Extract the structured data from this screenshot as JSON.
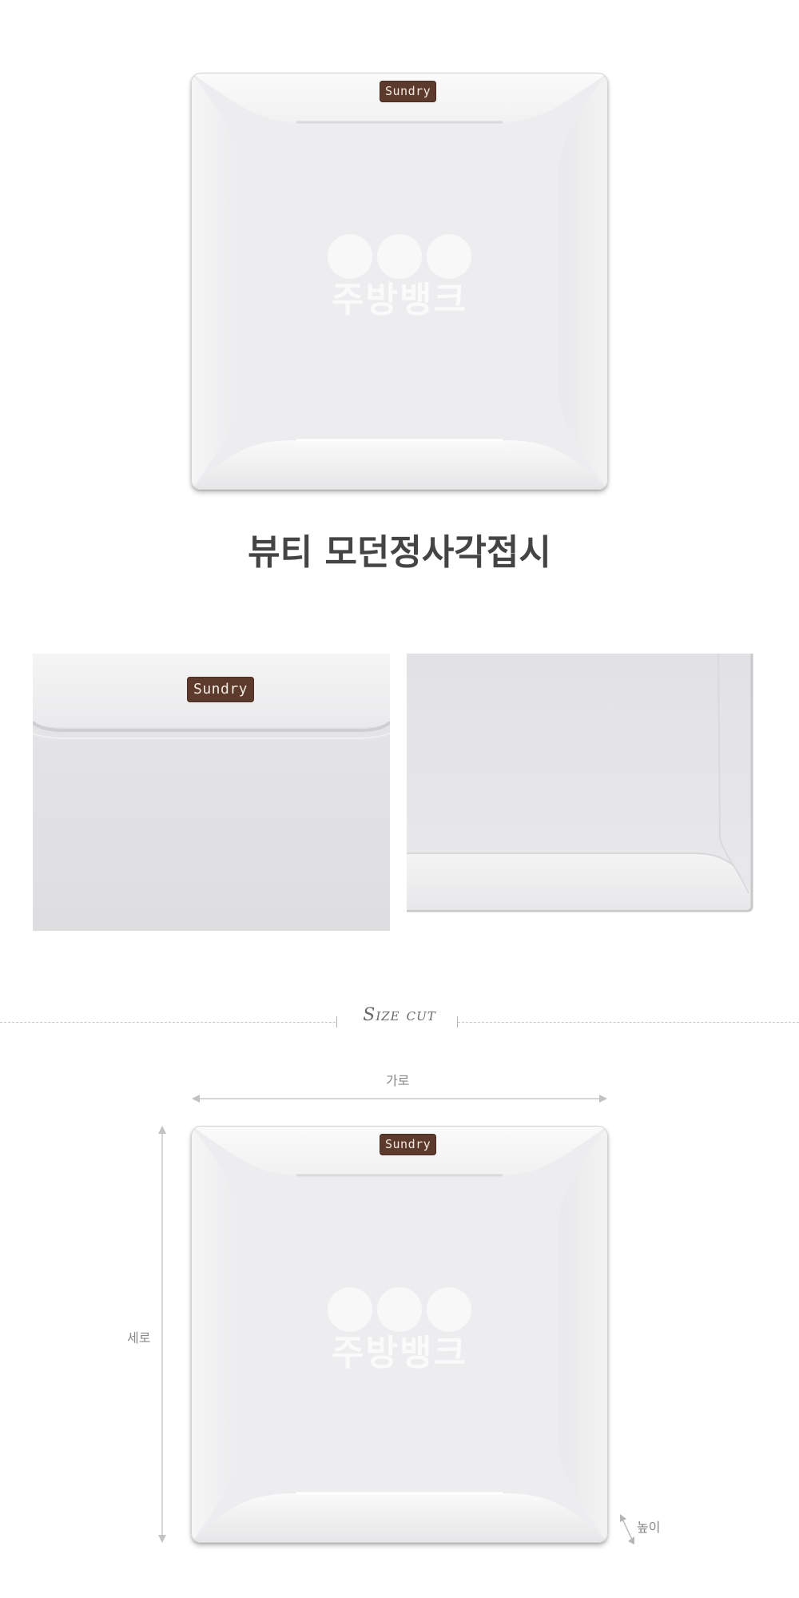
{
  "product": {
    "title": "뷰티 모던정사각접시",
    "brand_badge": "Sundry",
    "watermark_text": "주방뱅크"
  },
  "size_section": {
    "heading": "Size cut",
    "width_label": "가로",
    "height_label": "세로",
    "depth_label": "높이"
  },
  "colors": {
    "badge": "#5c3a2c",
    "title": "#444444",
    "plate": "#eeeeef"
  }
}
